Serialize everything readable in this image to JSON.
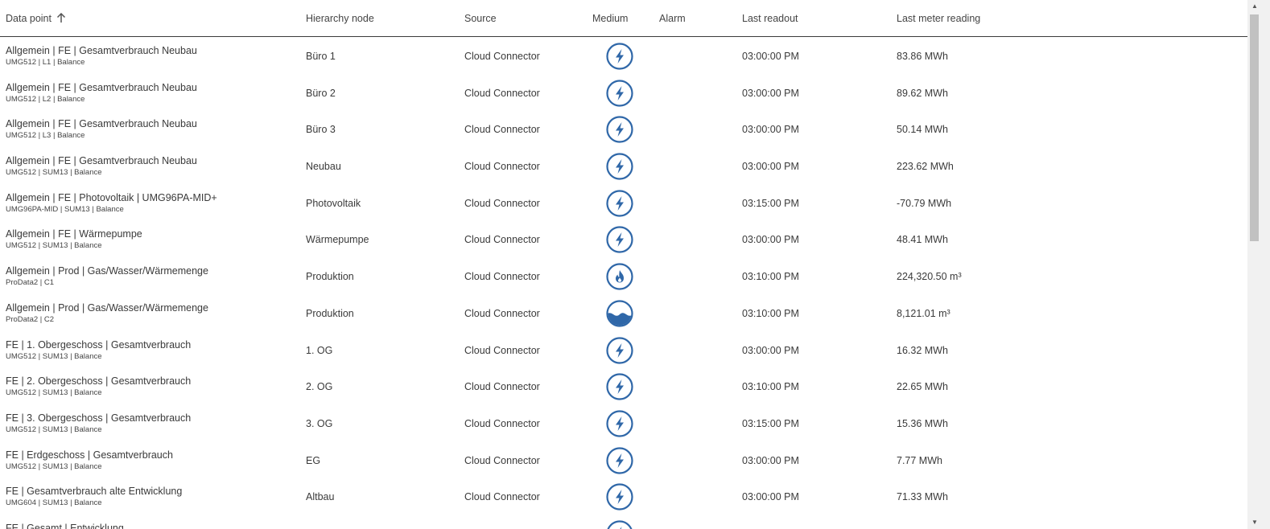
{
  "columns": {
    "data_point": "Data point",
    "hierarchy_node": "Hierarchy node",
    "source": "Source",
    "medium": "Medium",
    "alarm": "Alarm",
    "last_readout": "Last readout",
    "last_meter_reading": "Last meter reading"
  },
  "sort": {
    "column": "data_point",
    "direction": "ascending",
    "icon": "arrow-up-icon"
  },
  "colors": {
    "icon_blue": "#2f67a8",
    "text": "#3a3a3a",
    "header_border": "#3a3a3a"
  },
  "rows": [
    {
      "name": "Allgemein | FE | Gesamtverbrauch Neubau",
      "sub": "UMG512 | L1 | Balance",
      "node": "Büro 1",
      "source": "Cloud Connector",
      "medium": "electricity-icon",
      "readout": "03:00:00 PM",
      "reading": "83.86 MWh"
    },
    {
      "name": "Allgemein | FE | Gesamtverbrauch Neubau",
      "sub": "UMG512 | L2 | Balance",
      "node": "Büro 2",
      "source": "Cloud Connector",
      "medium": "electricity-icon",
      "readout": "03:00:00 PM",
      "reading": "89.62 MWh"
    },
    {
      "name": "Allgemein | FE | Gesamtverbrauch Neubau",
      "sub": "UMG512 | L3 | Balance",
      "node": "Büro 3",
      "source": "Cloud Connector",
      "medium": "electricity-icon",
      "readout": "03:00:00 PM",
      "reading": "50.14 MWh"
    },
    {
      "name": "Allgemein | FE | Gesamtverbrauch Neubau",
      "sub": "UMG512 | SUM13 | Balance",
      "node": "Neubau",
      "source": "Cloud Connector",
      "medium": "electricity-icon",
      "readout": "03:00:00 PM",
      "reading": "223.62 MWh"
    },
    {
      "name": "Allgemein | FE | Photovoltaik | UMG96PA-MID+",
      "sub": "UMG96PA-MID | SUM13 | Balance",
      "node": "Photovoltaik",
      "source": "Cloud Connector",
      "medium": "electricity-icon",
      "readout": "03:15:00 PM",
      "reading": "-70.79 MWh"
    },
    {
      "name": "Allgemein | FE | Wärmepumpe",
      "sub": "UMG512 | SUM13 | Balance",
      "node": "Wärmepumpe",
      "source": "Cloud Connector",
      "medium": "electricity-icon",
      "readout": "03:00:00 PM",
      "reading": "48.41 MWh"
    },
    {
      "name": "Allgemein | Prod | Gas/Wasser/Wärmemenge",
      "sub": "ProData2 | C1",
      "node": "Produktion",
      "source": "Cloud Connector",
      "medium": "gas-flame-icon",
      "readout": "03:10:00 PM",
      "reading": "224,320.50 m³"
    },
    {
      "name": "Allgemein | Prod | Gas/Wasser/Wärmemenge",
      "sub": "ProData2 | C2",
      "node": "Produktion",
      "source": "Cloud Connector",
      "medium": "water-icon",
      "readout": "03:10:00 PM",
      "reading": "8,121.01 m³"
    },
    {
      "name": "FE | 1. Obergeschoss | Gesamtverbrauch",
      "sub": "UMG512 | SUM13 | Balance",
      "node": "1. OG",
      "source": "Cloud Connector",
      "medium": "electricity-icon",
      "readout": "03:00:00 PM",
      "reading": "16.32 MWh"
    },
    {
      "name": "FE | 2. Obergeschoss | Gesamtverbrauch",
      "sub": "UMG512 | SUM13 | Balance",
      "node": "2. OG",
      "source": "Cloud Connector",
      "medium": "electricity-icon",
      "readout": "03:10:00 PM",
      "reading": "22.65 MWh"
    },
    {
      "name": "FE | 3. Obergeschoss | Gesamtverbrauch",
      "sub": "UMG512 | SUM13 | Balance",
      "node": "3. OG",
      "source": "Cloud Connector",
      "medium": "electricity-icon",
      "readout": "03:15:00 PM",
      "reading": "15.36 MWh"
    },
    {
      "name": "FE | Erdgeschoss | Gesamtverbrauch",
      "sub": "UMG512 | SUM13 | Balance",
      "node": "EG",
      "source": "Cloud Connector",
      "medium": "electricity-icon",
      "readout": "03:00:00 PM",
      "reading": "7.77 MWh"
    },
    {
      "name": "FE | Gesamtverbrauch alte Entwicklung",
      "sub": "UMG604 | SUM13 | Balance",
      "node": "Altbau",
      "source": "Cloud Connector",
      "medium": "electricity-icon",
      "readout": "03:00:00 PM",
      "reading": "71.33 MWh"
    },
    {
      "name": "FE | Gesamt | Entwicklung",
      "sub": "",
      "node": "",
      "source": "",
      "medium": "electricity-icon",
      "readout": "",
      "reading": ""
    }
  ]
}
